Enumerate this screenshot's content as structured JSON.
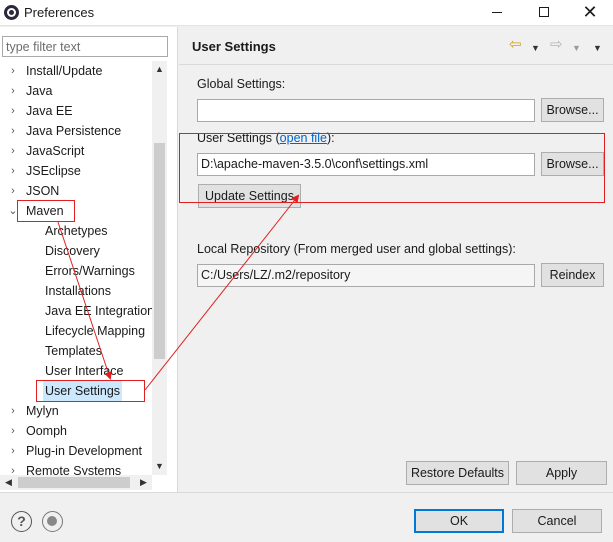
{
  "window": {
    "title": "Preferences",
    "minimize_glyph": "",
    "maximize_glyph": "",
    "close_glyph": "✕"
  },
  "sidebar": {
    "filter_placeholder": "type filter text",
    "items": [
      {
        "label": "Install/Update",
        "level": 0,
        "chevron": "›"
      },
      {
        "label": "Java",
        "level": 0,
        "chevron": "›"
      },
      {
        "label": "Java EE",
        "level": 0,
        "chevron": "›"
      },
      {
        "label": "Java Persistence",
        "level": 0,
        "chevron": "›"
      },
      {
        "label": "JavaScript",
        "level": 0,
        "chevron": "›"
      },
      {
        "label": "JSEclipse",
        "level": 0,
        "chevron": "›"
      },
      {
        "label": "JSON",
        "level": 0,
        "chevron": "›"
      },
      {
        "label": "Maven",
        "level": 0,
        "chevron": "⌄"
      },
      {
        "label": "Archetypes",
        "level": 1,
        "chevron": ""
      },
      {
        "label": "Discovery",
        "level": 1,
        "chevron": ""
      },
      {
        "label": "Errors/Warnings",
        "level": 1,
        "chevron": ""
      },
      {
        "label": "Installations",
        "level": 1,
        "chevron": ""
      },
      {
        "label": "Java EE Integration",
        "level": 1,
        "chevron": ""
      },
      {
        "label": "Lifecycle Mapping",
        "level": 1,
        "chevron": ""
      },
      {
        "label": "Templates",
        "level": 1,
        "chevron": ""
      },
      {
        "label": "User Interface",
        "level": 1,
        "chevron": ""
      },
      {
        "label": "User Settings",
        "level": 1,
        "chevron": "",
        "selected": true
      },
      {
        "label": "Mylyn",
        "level": 0,
        "chevron": "›"
      },
      {
        "label": "Oomph",
        "level": 0,
        "chevron": "›"
      },
      {
        "label": "Plug-in Development",
        "level": 0,
        "chevron": "›"
      },
      {
        "label": "Remote Systems",
        "level": 0,
        "chevron": "›"
      }
    ],
    "scroll_up": "▲",
    "scroll_down": "▼",
    "scroll_left": "◀",
    "scroll_right": "▶"
  },
  "main": {
    "title": "User Settings",
    "global_settings_label": "Global Settings:",
    "global_settings_value": "",
    "browse_label": "Browse...",
    "user_settings_label": "User Settings (",
    "open_file_link": "open file",
    "user_settings_label_end": "):",
    "user_settings_value": "D:\\apache-maven-3.5.0\\conf\\settings.xml",
    "update_settings_label": "Update Settings",
    "local_repo_label": "Local Repository (From merged user and global settings):",
    "local_repo_value": "C:/Users/LZ/.m2/repository",
    "reindex_label": "Reindex",
    "restore_defaults_label": "Restore Defaults",
    "apply_label": "Apply"
  },
  "nav": {
    "back_glyph": "⇦",
    "fwd_glyph": "⇨",
    "dropdown_glyph": "▼"
  },
  "footer": {
    "help_glyph": "?",
    "ok_label": "OK",
    "cancel_label": "Cancel"
  },
  "colors": {
    "annotation_red": "#e02020",
    "link_blue": "#0066cc",
    "selection_bg": "#cce8ff",
    "primary_border": "#0078d7"
  }
}
